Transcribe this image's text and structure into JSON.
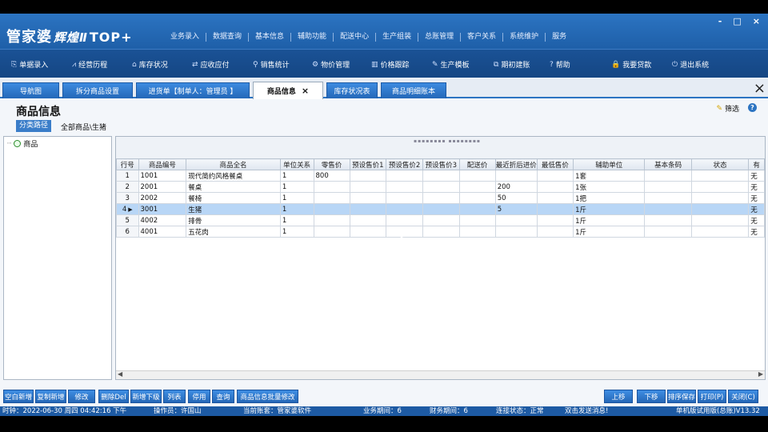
{
  "app": {
    "logo_main": "管家婆",
    "logo_sub": "辉煌Ⅱ",
    "logo_top": "TOP+",
    "window_controls": [
      "-",
      "□",
      "×"
    ]
  },
  "main_menu": [
    "业务录入",
    "数据查询",
    "基本信息",
    "辅助功能",
    "配送中心",
    "生产组装",
    "总账管理",
    "客户关系",
    "系统维护",
    "服务"
  ],
  "toolbar": [
    {
      "label": "单据录入",
      "icon": "document-icon",
      "glyph": "⎘"
    },
    {
      "label": "经营历程",
      "icon": "chart-icon",
      "glyph": "⩘"
    },
    {
      "label": "库存状况",
      "icon": "home-icon",
      "glyph": "⌂"
    },
    {
      "label": "应收应付",
      "icon": "exchange-icon",
      "glyph": "⇄"
    },
    {
      "label": "销售统计",
      "icon": "search-icon",
      "glyph": "⚲"
    },
    {
      "label": "物价管理",
      "icon": "gear-icon",
      "glyph": "⚙"
    },
    {
      "label": "价格跟踪",
      "icon": "bar-chart-icon",
      "glyph": "▥"
    },
    {
      "label": "生产模板",
      "icon": "wrench-icon",
      "glyph": "✎"
    },
    {
      "label": "期初建账",
      "icon": "open-link-icon",
      "glyph": "⧉"
    },
    {
      "label": "帮助",
      "icon": "help-icon",
      "glyph": "?"
    },
    {
      "label": "我要贷款",
      "icon": "lock-icon",
      "glyph": "🔒"
    },
    {
      "label": "退出系统",
      "icon": "power-icon",
      "glyph": "⏻"
    }
  ],
  "tabs": [
    {
      "label": "导航图"
    },
    {
      "label": "拆分商品设置"
    },
    {
      "label": "进货单【制单人：管理员 】"
    },
    {
      "label": "商品信息",
      "active": true,
      "close": "×"
    },
    {
      "label": "库存状况表"
    },
    {
      "label": "商品明细账本"
    }
  ],
  "close_all": "×",
  "page": {
    "title": "商品信息",
    "filter_label": "筛选",
    "help": "?",
    "path_label": "分类路径",
    "path_value": "全部商品\\生猪"
  },
  "tree": {
    "root_label": "商品"
  },
  "grid": {
    "columns": [
      "行号",
      "商品编号",
      "商品全名",
      "单位关系",
      "零售价",
      "预设售价1",
      "预设售价2",
      "预设售价3",
      "配送价",
      "最近折后进价",
      "最低售价",
      "辅助单位",
      "基本条码",
      "状态",
      "有"
    ],
    "rows": [
      [
        "1",
        "1001",
        "现代简约风格餐桌",
        "1",
        "800",
        "",
        "",
        "",
        "",
        "",
        "",
        "1套",
        "",
        "",
        "无"
      ],
      [
        "2",
        "2001",
        "餐桌",
        "1",
        "",
        "",
        "",
        "",
        "",
        "200",
        "",
        "1张",
        "",
        "",
        "无"
      ],
      [
        "3",
        "2002",
        "餐椅",
        "1",
        "",
        "",
        "",
        "",
        "",
        "50",
        "",
        "1把",
        "",
        "",
        "无"
      ],
      [
        "4",
        "3001",
        "生猪",
        "1",
        "",
        "",
        "",
        "",
        "",
        "5",
        "",
        "1斤",
        "",
        "",
        "无"
      ],
      [
        "5",
        "4002",
        "排骨",
        "1",
        "",
        "",
        "",
        "",
        "",
        "",
        "",
        "1斤",
        "",
        "",
        "无"
      ],
      [
        "6",
        "4001",
        "五花肉",
        "1",
        "",
        "",
        "",
        "",
        "",
        "",
        "",
        "1斤",
        "",
        "",
        "无"
      ]
    ],
    "selected_row": 3,
    "row_pointer": "▶",
    "scroll_left": "◀",
    "scroll_right": "▶"
  },
  "left_buttons": [
    "空白新增",
    "复制新增",
    "修改",
    "删除Del",
    "新增下级",
    "列表",
    "停用",
    "查询",
    "商品信息批量修改"
  ],
  "right_buttons": [
    "上移",
    "下移",
    "排序保存",
    "打印(P)",
    "关闭(C)"
  ],
  "status": {
    "time": "时钟：2022-06-30 周四 04:42:16 下午",
    "operator": "操作员：许国山",
    "account": "当前账套：管家婆软件",
    "biz_period": "业务期间：6",
    "fin_period": "财务期间：6",
    "conn": "连接状态：正常",
    "msg": "双击发送消息!",
    "version": "单机版试用版(总账)V13.32"
  }
}
